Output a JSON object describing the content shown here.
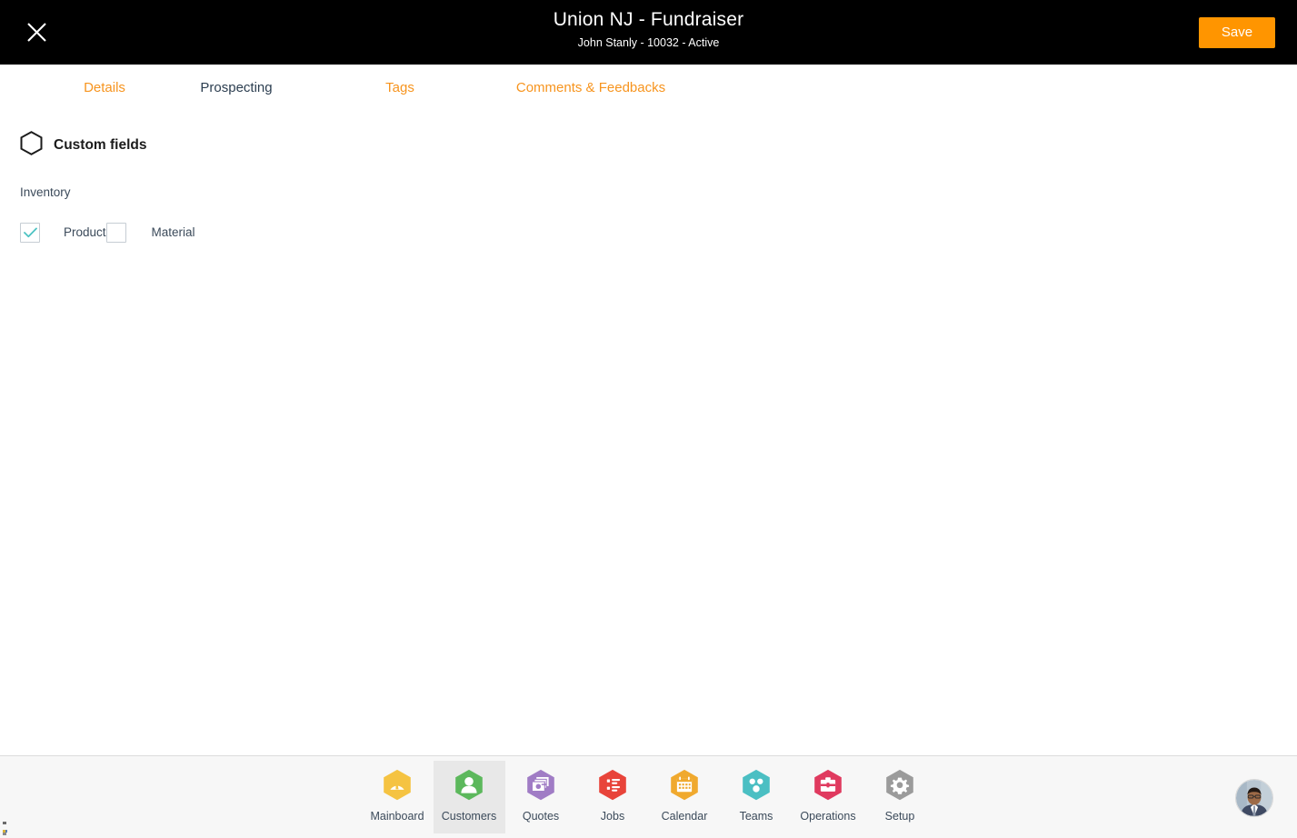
{
  "header": {
    "close_icon": "close-icon",
    "title": "Union NJ - Fundraiser",
    "subtitle": "John Stanly - 10032 - Active",
    "save_label": "Save",
    "save_color": "#ff9500",
    "background": "#000000"
  },
  "tabs": {
    "accent_color": "#f7941e",
    "active_color": "#2c3e50",
    "items": [
      {
        "label": "Details",
        "active": false
      },
      {
        "label": "Prospecting",
        "active": true
      },
      {
        "label": "Tags",
        "active": false
      },
      {
        "label": "Comments & Feedbacks",
        "active": false
      }
    ]
  },
  "content": {
    "section_icon": "hexagon-icon",
    "section_title": "Custom fields",
    "group_label": "Inventory",
    "checkboxes": [
      {
        "label": "Product",
        "checked": true
      },
      {
        "label": "Material",
        "checked": false
      }
    ],
    "check_color": "#4ec3c3"
  },
  "bottom_nav": {
    "items": [
      {
        "label": "Mainboard",
        "icon": "dashboard-gauge-icon",
        "color": "#f5c342",
        "active": false
      },
      {
        "label": "Customers",
        "icon": "person-icon",
        "color": "#5cb85c",
        "active": true
      },
      {
        "label": "Quotes",
        "icon": "documents-icon",
        "color": "#a07cc5",
        "active": false
      },
      {
        "label": "Jobs",
        "icon": "checklist-icon",
        "color": "#e8443a",
        "active": false
      },
      {
        "label": "Calendar",
        "icon": "calendar-icon",
        "color": "#f0a92e",
        "active": false
      },
      {
        "label": "Teams",
        "icon": "team-dots-icon",
        "color": "#4bbfc3",
        "active": false
      },
      {
        "label": "Operations",
        "icon": "briefcase-icon",
        "color": "#e03a5f",
        "active": false
      },
      {
        "label": "Setup",
        "icon": "gear-icon",
        "color": "#9b9b9b",
        "active": false
      }
    ],
    "avatar": "user-avatar",
    "background": "#f7f7f7",
    "active_background": "#e8e8e8"
  }
}
